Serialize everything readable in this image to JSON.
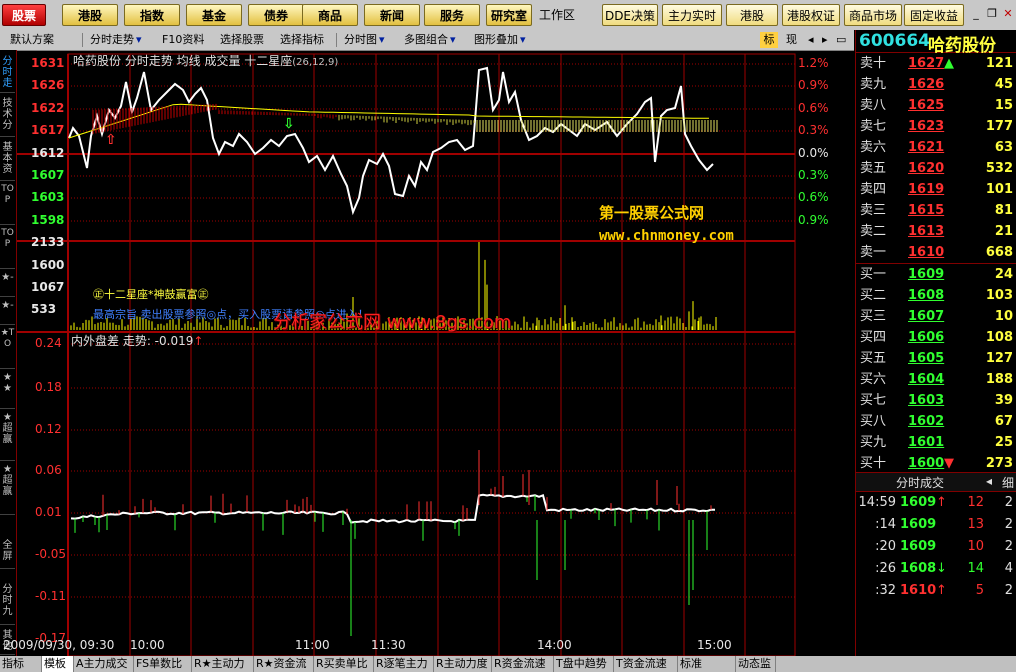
{
  "toolbar": {
    "stock_tab": "股票",
    "buttons": [
      "港股",
      "指数",
      "基金",
      "债券",
      "商品",
      "新闻",
      "服务"
    ],
    "lab": "研究室",
    "workspace": "工作区",
    "quick": [
      "DDE决策",
      "主力实时监",
      "港股",
      "港股权证",
      "商品市场",
      "固定收益平"
    ]
  },
  "bar2": {
    "items": [
      "默认方案",
      "分时走势",
      "F10资料",
      "选择股票",
      "选择指标",
      "分时图",
      "多图组合",
      "图形叠加"
    ],
    "right_items": [
      "标",
      "现"
    ]
  },
  "left_tabs": [
    "分时走",
    "技术分",
    "基本资",
    "TOP",
    "TOP",
    "★-",
    "★-",
    "★TO",
    "★★",
    "★超赢",
    "★超赢",
    "全屏",
    "分时九",
    "其他"
  ],
  "chart": {
    "header": "哈药股份  分时走势  均线  成交量  十二星座",
    "header_params": "(26,12,9)",
    "left_prices": [
      {
        "v": "1631",
        "c": "red"
      },
      {
        "v": "1626",
        "c": "red"
      },
      {
        "v": "1622",
        "c": "red"
      },
      {
        "v": "1617",
        "c": "red"
      },
      {
        "v": "1612",
        "c": "white"
      },
      {
        "v": "1607",
        "c": "green"
      },
      {
        "v": "1603",
        "c": "green"
      },
      {
        "v": "1598",
        "c": "green"
      }
    ],
    "right_pcts": [
      {
        "v": "1.2%",
        "c": "red"
      },
      {
        "v": "0.9%",
        "c": "red"
      },
      {
        "v": "0.6%",
        "c": "red"
      },
      {
        "v": "0.3%",
        "c": "red"
      },
      {
        "v": "0.0%",
        "c": "white"
      },
      {
        "v": "0.3%",
        "c": "green"
      },
      {
        "v": "0.6%",
        "c": "green"
      },
      {
        "v": "0.9%",
        "c": "green"
      }
    ],
    "volume_labels": [
      "2133",
      "1600",
      "1067",
      "533"
    ],
    "watermark1": "第一股票公式网",
    "watermark2": "www.chnmoney.com",
    "overlay_text1": "㊣十二星座*神鼓赢富㊣",
    "overlay_text2": "最高宗旨 卖出股票参照◎点，买入股票请参照◎点进入！",
    "watermark3": "分析家公式网 www.8gs.com",
    "indicator_header": "内外盘差  走势: -0.019",
    "indicator_labels": [
      "0.24",
      "0.18",
      "0.12",
      "0.06",
      "0.01",
      "-0.05",
      "-0.11",
      "-0.17"
    ],
    "x_labels": [
      "2009/09/30, 09:30",
      "10:00",
      "11:00",
      "11:30",
      "14:00",
      "15:00"
    ]
  },
  "right_panel": {
    "code": "600664",
    "name": "哈药股份",
    "sells": [
      {
        "label": "卖十",
        "price": "1627",
        "vol": "121",
        "arrow": "up"
      },
      {
        "label": "卖九",
        "price": "1626",
        "vol": "45"
      },
      {
        "label": "卖八",
        "price": "1625",
        "vol": "15"
      },
      {
        "label": "卖七",
        "price": "1623",
        "vol": "177"
      },
      {
        "label": "卖六",
        "price": "1621",
        "vol": "63"
      },
      {
        "label": "卖五",
        "price": "1620",
        "vol": "532"
      },
      {
        "label": "卖四",
        "price": "1619",
        "vol": "101"
      },
      {
        "label": "卖三",
        "price": "1615",
        "vol": "81"
      },
      {
        "label": "卖二",
        "price": "1613",
        "vol": "21"
      },
      {
        "label": "卖一",
        "price": "1610",
        "vol": "668"
      }
    ],
    "buys": [
      {
        "label": "买一",
        "price": "1609",
        "vol": "24"
      },
      {
        "label": "买二",
        "price": "1608",
        "vol": "103"
      },
      {
        "label": "买三",
        "price": "1607",
        "vol": "10"
      },
      {
        "label": "买四",
        "price": "1606",
        "vol": "108"
      },
      {
        "label": "买五",
        "price": "1605",
        "vol": "127"
      },
      {
        "label": "买六",
        "price": "1604",
        "vol": "188"
      },
      {
        "label": "买七",
        "price": "1603",
        "vol": "39"
      },
      {
        "label": "买八",
        "price": "1602",
        "vol": "67"
      },
      {
        "label": "买九",
        "price": "1601",
        "vol": "25"
      },
      {
        "label": "买十",
        "price": "1600",
        "vol": "273",
        "arrow": "down"
      }
    ],
    "ticks_tab": "分时成交",
    "ticks_tab2": "细",
    "ticks": [
      {
        "time": "14:59",
        "price": "1609",
        "arrow": "up",
        "vol": "12",
        "n": "2"
      },
      {
        "time": ":14",
        "price": "1609",
        "arrow": "",
        "vol": "13",
        "n": "2"
      },
      {
        "time": ":20",
        "price": "1609",
        "arrow": "",
        "vol": "10",
        "n": "2"
      },
      {
        "time": ":26",
        "price": "1608",
        "arrow": "down",
        "vol": "14",
        "n": "4"
      },
      {
        "time": ":32",
        "price": "1610",
        "arrow": "up",
        "vol": "5",
        "n": "2"
      }
    ]
  },
  "bottom_tabs": [
    "指标",
    "模板",
    "A主力成交",
    "FS单数比",
    "R★主动力",
    "R★资金流",
    "R买卖单比",
    "R逐笔主力",
    "R主动力度",
    "R资金流速",
    "T盘中趋势",
    "T资金流速",
    "标准",
    "动态监"
  ],
  "colors": {
    "up": "#ff3030",
    "down": "#30ff30",
    "grid": "#a00000",
    "price_line": "#ffffff",
    "avg_line": "#ffff00",
    "volume": "#ffff00"
  }
}
